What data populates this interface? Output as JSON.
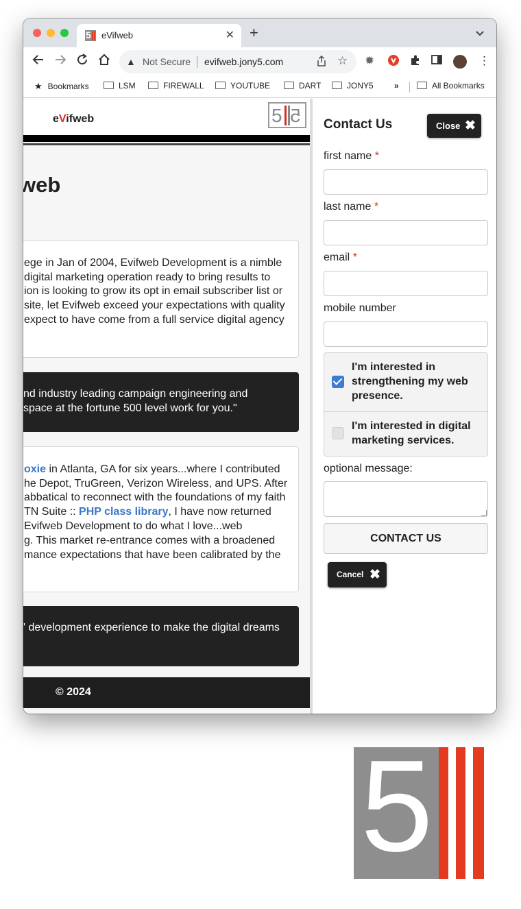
{
  "browser": {
    "tab_title": "eVifweb",
    "tab_close": "✕",
    "new_tab": "+",
    "tab_menu": "⌄",
    "security_label": "Not Secure",
    "url": "evifweb.jony5.com",
    "bookmarks": [
      {
        "label": "Bookmarks",
        "icon": "star-icon"
      },
      {
        "label": "LSM",
        "icon": "folder-icon"
      },
      {
        "label": "FIREWALL",
        "icon": "folder-icon"
      },
      {
        "label": "YOUTUBE",
        "icon": "folder-icon"
      },
      {
        "label": "DART",
        "icon": "folder-icon"
      },
      {
        "label": "JONY5",
        "icon": "folder-icon"
      }
    ],
    "more_bookmarks": "»",
    "all_bookmarks": "All Bookmarks",
    "traffic_lights": [
      "#fe5f57",
      "#febc2e",
      "#28c840"
    ]
  },
  "site": {
    "brand_prefix": "e",
    "brand_v": "V",
    "brand_suffix": "ifweb",
    "logo_number": "5",
    "page_title": "web",
    "intro_lines": [
      "ege in Jan of 2004, Evifweb Development is a nimble",
      " digital marketing operation ready to bring results to",
      "ion is looking to grow its opt in email subscriber list or",
      "site, let Evifweb exceed your expectations with quality",
      "expect to have come from a full service digital agency"
    ],
    "quote1_lines": [
      "nd industry leading campaign engineering and",
      " space at the fortune 500 level work for you.\""
    ],
    "bio": {
      "link1": "oxie",
      "line1_rest": " in Atlanta, GA for six years...where I contributed",
      "line2": "he Depot, TruGreen, Verizon Wireless, and UPS. After",
      "line3": "abbatical to reconnect with the foundations of my faith",
      "line4_pre": "TN Suite :: ",
      "link2": "PHP class library",
      "line4_post": ", I have now returned",
      "line5": "Evifweb Development to do what I love...web",
      "line6": "g. This market re-entrance comes with a broadened",
      "line7": "mance expectations that have been calibrated by the"
    },
    "quote2_line": "' development experience to make the digital dreams",
    "copyright": "© 2024"
  },
  "contact_panel": {
    "title": "Contact Us",
    "close_label": "Close",
    "close_icon": "✖",
    "required_marker": "*",
    "fields": {
      "first_name": {
        "label": "first name",
        "value": "",
        "placeholder": ""
      },
      "last_name": {
        "label": "last name",
        "value": "",
        "placeholder": ""
      },
      "email": {
        "label": "email",
        "value": "",
        "placeholder": ""
      },
      "mobile": {
        "label": "mobile number",
        "value": "",
        "placeholder": ""
      }
    },
    "checkboxes": [
      {
        "label": "I'm interested in strengthening my web presence.",
        "checked": true
      },
      {
        "label": "I'm interested in digital marketing services.",
        "checked": false
      }
    ],
    "message_label": "optional message:",
    "submit_label": "CONTACT US",
    "cancel_label": "Cancel",
    "cancel_icon": "✖"
  },
  "brand_colors": {
    "red": "#e33a20",
    "gray": "#8e8e8e",
    "dark": "#222222",
    "link": "#3a78c4"
  }
}
